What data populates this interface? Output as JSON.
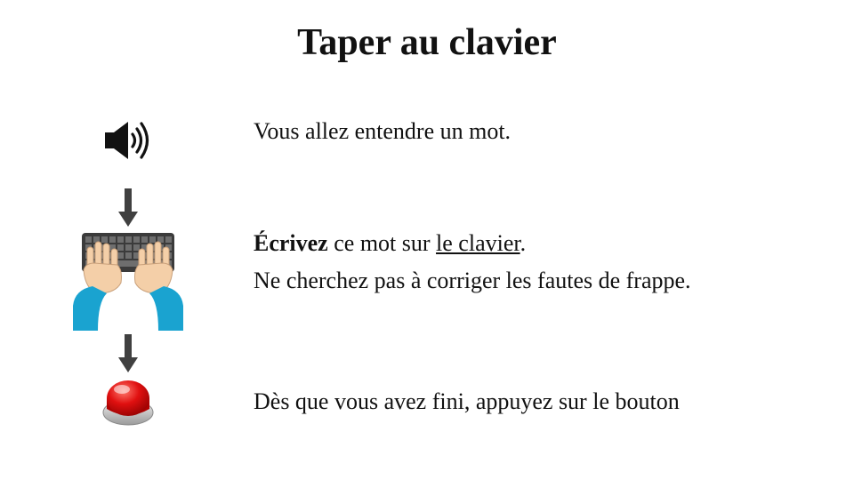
{
  "title": "Taper au clavier",
  "steps": {
    "listen": {
      "icon": "speaker-icon",
      "text": "Vous allez entendre un mot."
    },
    "type": {
      "icon": "typing-hands-keyboard-icon",
      "emphasis": "Écrivez",
      "middle": " ce mot sur ",
      "link": "le clavier",
      "end": ".",
      "line2": "Ne cherchez pas à corriger les fautes de frappe."
    },
    "press": {
      "icon": "red-push-button-icon",
      "text": "Dès que vous avez fini, appuyez sur le bouton"
    }
  },
  "arrow_icon": "down-arrow-icon",
  "colors": {
    "text": "#111111",
    "arrow": "#404040",
    "sleeve": "#1aa3d0",
    "skin": "#f4cfa8",
    "button_red": "#e01010"
  }
}
